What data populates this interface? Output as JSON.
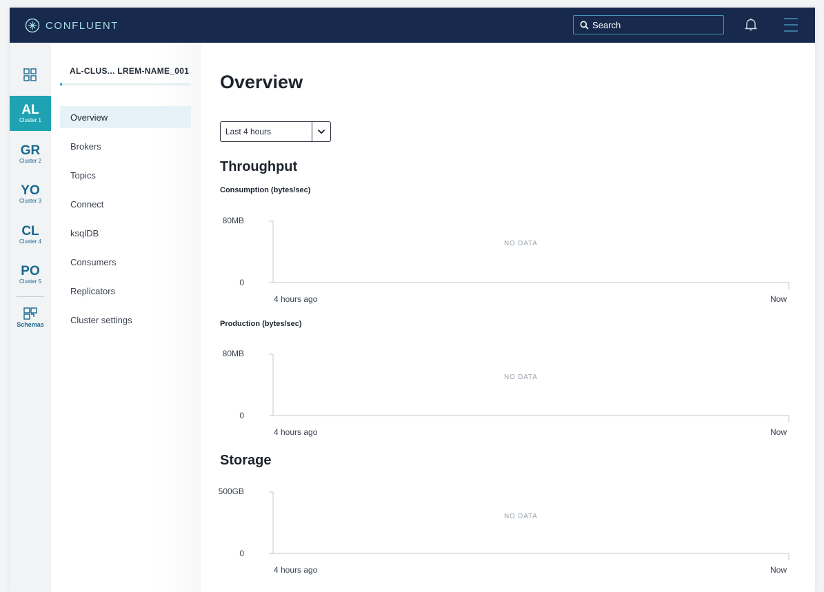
{
  "brand": {
    "name": "CONFLUENT"
  },
  "header": {
    "search_placeholder": "Search",
    "icons": {
      "search": "search-icon",
      "bell": "bell-icon",
      "menu": "hamburger-menu-icon"
    }
  },
  "rail": {
    "apps_icon": "grid-apps-icon",
    "clusters": [
      {
        "abbr": "AL",
        "label": "Cluster 1",
        "active": true
      },
      {
        "abbr": "GR",
        "label": "Cluster 2",
        "active": false
      },
      {
        "abbr": "YO",
        "label": "Cluster 3",
        "active": false
      },
      {
        "abbr": "CL",
        "label": "Cluster 4",
        "active": false
      },
      {
        "abbr": "PO",
        "label": "Cluster 5",
        "active": false
      }
    ],
    "schemas_label": "Schemas"
  },
  "sidenav": {
    "cluster_name": "AL-CLUS... LREM-NAME_001",
    "items": [
      {
        "label": "Overview",
        "active": true
      },
      {
        "label": "Brokers",
        "active": false
      },
      {
        "label": "Topics",
        "active": false
      },
      {
        "label": "Connect",
        "active": false
      },
      {
        "label": "ksqlDB",
        "active": false
      },
      {
        "label": "Consumers",
        "active": false
      },
      {
        "label": "Replicators",
        "active": false
      },
      {
        "label": "Cluster settings",
        "active": false
      }
    ]
  },
  "main": {
    "title": "Overview",
    "time_range": {
      "selected": "Last 4 hours"
    },
    "throughput_title": "Throughput",
    "storage_title": "Storage"
  },
  "chart_data": [
    {
      "type": "line",
      "title": "Consumption (bytes/sec)",
      "y_ticks": [
        "80MB",
        "0"
      ],
      "x_ticks": [
        "4 hours ago",
        "Now"
      ],
      "series": [],
      "annotation": "NO DATA"
    },
    {
      "type": "line",
      "title": "Production (bytes/sec)",
      "y_ticks": [
        "80MB",
        "0"
      ],
      "x_ticks": [
        "4 hours ago",
        "Now"
      ],
      "series": [],
      "annotation": "NO DATA"
    },
    {
      "type": "line",
      "title": "",
      "y_ticks": [
        "500GB",
        "0"
      ],
      "x_ticks": [
        "4 hours ago",
        "Now"
      ],
      "series": [],
      "annotation": "NO DATA"
    }
  ],
  "colors": {
    "header_bg": "#17294d",
    "accent": "#1fa3b3",
    "cluster_text": "#17698e",
    "active_nav_bg": "#e5f3f8"
  }
}
